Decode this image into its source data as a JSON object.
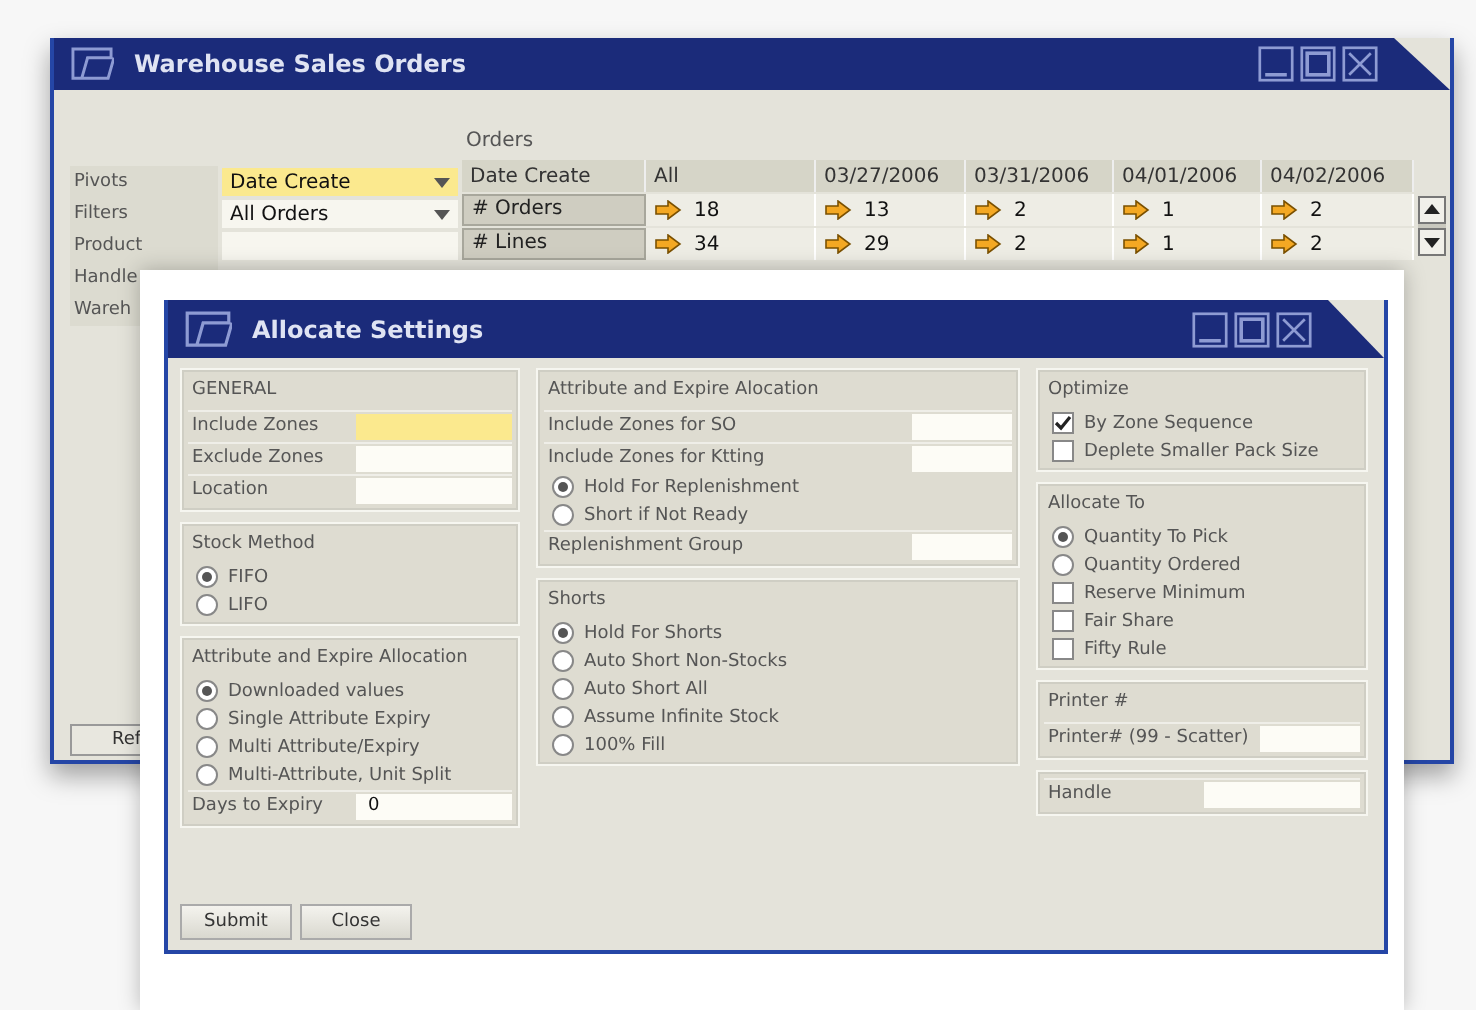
{
  "main_window": {
    "title": "Warehouse Sales Orders",
    "pivot_fields": [
      {
        "label": "Pivots",
        "value": "Date Create",
        "highlighted": true,
        "dropdown": true
      },
      {
        "label": "Filters",
        "value": "All Orders",
        "highlighted": false,
        "dropdown": true
      },
      {
        "label": "Product",
        "highlighted": false,
        "dropdown": false
      },
      {
        "label": "Handle"
      },
      {
        "label": "Wareh"
      }
    ],
    "grid_title": "Orders",
    "columns": [
      "Date Create",
      "All",
      "03/27/2006",
      "03/31/2006",
      "04/01/2006",
      "04/02/2006"
    ],
    "rows": [
      {
        "cells": [
          "# Orders",
          "18",
          "13",
          "2",
          "1",
          "2"
        ]
      },
      {
        "cells": [
          "# Lines",
          "34",
          "29",
          "2",
          "1",
          "2"
        ]
      }
    ],
    "refresh_button": "Ref"
  },
  "dialog": {
    "title": "Allocate Settings",
    "columns": [
      [
        {
          "title": "GENERAL",
          "items": [
            {
              "kind": "field",
              "label": "Include Zones",
              "highlighted": true
            },
            {
              "kind": "field",
              "label": "Exclude Zones",
              "highlighted": false
            },
            {
              "kind": "field",
              "label": "Location",
              "highlighted": false
            }
          ]
        },
        {
          "title": "Stock Method",
          "items": [
            {
              "kind": "radio",
              "label": "FIFO",
              "selected": true
            },
            {
              "kind": "radio",
              "label": "LIFO",
              "selected": false
            }
          ]
        },
        {
          "title": "Attribute and Expire Allocation",
          "items": [
            {
              "kind": "radio",
              "label": "Downloaded values",
              "selected": true
            },
            {
              "kind": "radio",
              "label": "Single Attribute Expiry",
              "selected": false
            },
            {
              "kind": "radio",
              "label": "Multi Attribute/Expiry",
              "selected": false
            },
            {
              "kind": "radio",
              "label": "Multi-Attribute, Unit Split",
              "selected": false
            },
            {
              "kind": "field",
              "label": "Days to Expiry",
              "value": "0",
              "highlighted": false
            }
          ]
        }
      ],
      [
        {
          "title": "Attribute and Expire Alocation",
          "items": [
            {
              "kind": "field",
              "label": "Include Zones for SO",
              "highlighted": false
            },
            {
              "kind": "field",
              "label": "Include Zones for Ktting",
              "highlighted": false
            },
            {
              "kind": "radio",
              "label": "Hold For Replenishment",
              "selected": true
            },
            {
              "kind": "radio",
              "label": "Short if Not Ready",
              "selected": false
            },
            {
              "kind": "field",
              "label": "Replenishment Group",
              "highlighted": false
            }
          ]
        },
        {
          "title": "Shorts",
          "items": [
            {
              "kind": "radio",
              "label": "Hold For Shorts",
              "selected": true
            },
            {
              "kind": "radio",
              "label": "Auto Short Non-Stocks",
              "selected": false
            },
            {
              "kind": "radio",
              "label": "Auto Short All",
              "selected": false
            },
            {
              "kind": "radio",
              "label": "Assume Infinite Stock",
              "selected": false
            },
            {
              "kind": "radio",
              "label": "100% Fill",
              "selected": false
            }
          ]
        }
      ],
      [
        {
          "title": "Optimize",
          "items": [
            {
              "kind": "check",
              "label": "By Zone Sequence",
              "checked": true
            },
            {
              "kind": "check",
              "label": "Deplete Smaller Pack Size",
              "checked": false
            }
          ]
        },
        {
          "title": "Allocate To",
          "items": [
            {
              "kind": "radio",
              "label": "Quantity To Pick",
              "selected": true
            },
            {
              "kind": "radio",
              "label": "Quantity Ordered",
              "selected": false
            },
            {
              "kind": "check",
              "label": "Reserve Minimum",
              "checked": false
            },
            {
              "kind": "check",
              "label": "Fair Share",
              "checked": false
            },
            {
              "kind": "check",
              "label": "Fifty Rule",
              "checked": false
            }
          ]
        },
        {
          "title": "Printer #",
          "items": [
            {
              "kind": "field",
              "label": "Printer# (99 - Scatter)",
              "highlighted": false
            }
          ]
        },
        {
          "items": [
            {
              "kind": "field",
              "label": "Handle",
              "highlighted": false
            }
          ]
        }
      ]
    ],
    "buttons": [
      "Submit",
      "Close"
    ]
  }
}
